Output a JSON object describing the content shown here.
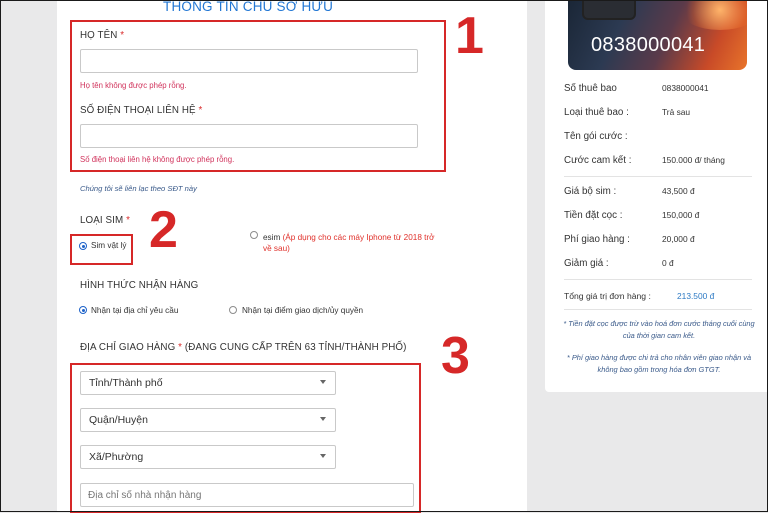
{
  "form": {
    "section_title": "THÔNG TIN CHỦ SỞ HỮU",
    "name": {
      "label": "HỌ TÊN",
      "required_mark": "*",
      "value": "",
      "error": "Họ tên không được phép rỗng."
    },
    "phone": {
      "label": "SỐ ĐIỆN THOẠI LIÊN HỆ",
      "required_mark": "*",
      "value": "",
      "error": "Số điện thoại liên hệ không được phép rỗng.",
      "hint": "Chúng tôi sẽ liên lạc theo SĐT này"
    },
    "sim_type": {
      "label": "LOẠI SIM",
      "required_mark": "*",
      "physical_label": "Sim vật lý",
      "esim_label": "esim",
      "esim_note": "(Áp dụng cho các máy Iphone từ 2018 trở về sau)",
      "selected": "physical"
    },
    "delivery_method": {
      "label": "HÌNH THỨC NHẬN HÀNG",
      "option_address": "Nhận tại địa chỉ yêu cầu",
      "option_point": "Nhận tại điểm giao dịch/ủy quyền",
      "selected": "address"
    },
    "address": {
      "label": "ĐỊA CHỈ GIAO HÀNG",
      "required_mark": "*",
      "label_suffix": "(ĐANG CUNG CẤP TRÊN 63 TỈNH/THÀNH PHỐ)",
      "province": "Tỉnh/Thành phố",
      "district": "Quận/Huyện",
      "ward": "Xã/Phường",
      "street_placeholder": "Địa chỉ số nhà nhận hàng"
    }
  },
  "annotations": {
    "step1": "1",
    "step2": "2",
    "step3": "3",
    "color": "#d62828"
  },
  "summary": {
    "card_number": "0838000041",
    "rows_top": [
      {
        "label": "Số thuê bao",
        "value": "0838000041"
      },
      {
        "label": "Loại thuê bao :",
        "value": "Trả sau"
      },
      {
        "label": "Tên gói cước :",
        "value": ""
      },
      {
        "label": "Cước cam kết :",
        "value": "150.000 đ/ tháng"
      }
    ],
    "rows_costs": [
      {
        "label": "Giá bộ sim :",
        "value": "43,500 đ"
      },
      {
        "label": "Tiền đặt cọc :",
        "value": "150,000 đ"
      },
      {
        "label": "Phí giao hàng :",
        "value": "20,000 đ"
      },
      {
        "label": "Giảm giá :",
        "value": "0 đ"
      }
    ],
    "total": {
      "label": "Tổng giá trị đơn hàng :",
      "value": "213.500 đ"
    },
    "notes": [
      "* Tiền đặt cọc được trừ vào hoá đơn cước tháng cuối cùng của thời gian cam kết.",
      "* Phí giao hàng được chi trả cho nhân viên giao nhận và không bao gồm trong hóa đơn GTGT."
    ]
  },
  "colors": {
    "accent": "#2277d4",
    "error": "#d1335c",
    "annotation": "#d62828",
    "total": "#2d7ac4"
  }
}
